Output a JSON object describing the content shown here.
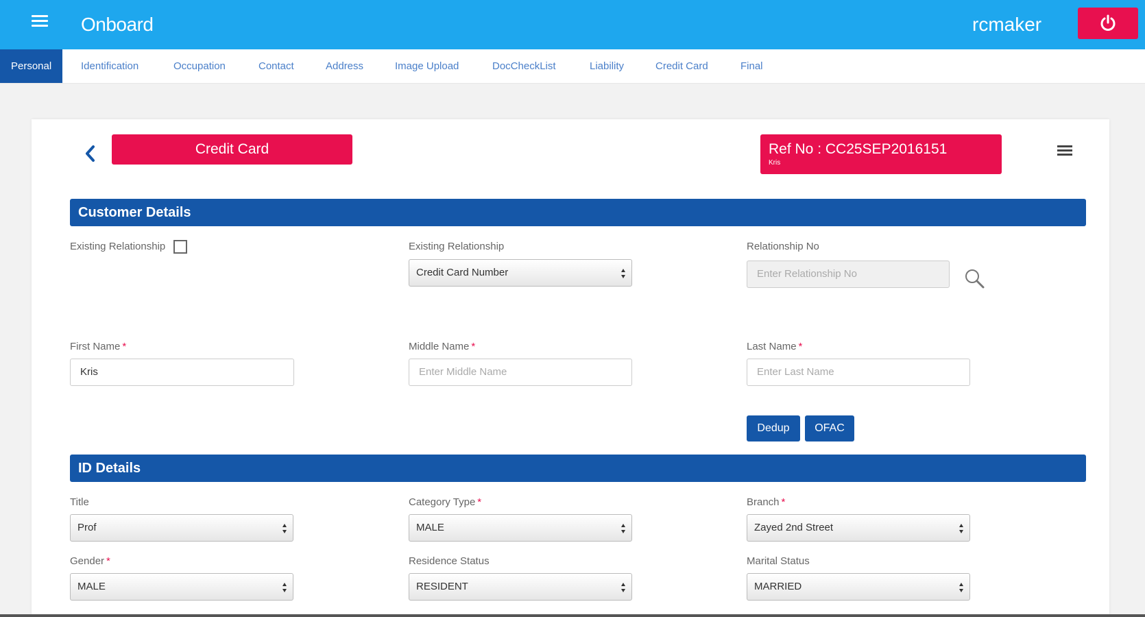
{
  "header": {
    "title": "Onboard",
    "username": "rcmaker"
  },
  "tabs": [
    {
      "label": "Personal",
      "active": true
    },
    {
      "label": "Identification"
    },
    {
      "label": "Occupation"
    },
    {
      "label": "Contact"
    },
    {
      "label": "Address"
    },
    {
      "label": "Image Upload"
    },
    {
      "label": "DocCheckList"
    },
    {
      "label": "Liability"
    },
    {
      "label": "Credit Card"
    },
    {
      "label": "Final"
    }
  ],
  "product": {
    "label": "Credit Card"
  },
  "reference": {
    "ref_no": "Ref No : CC25SEP2016151",
    "name": "Kris"
  },
  "customer_details": {
    "title": "Customer Details",
    "existing_relationship_checkbox_label": "Existing Relationship",
    "existing_relationship_checked": false,
    "existing_relationship_select_label": "Existing Relationship",
    "existing_relationship_select_value": "Credit Card Number",
    "relationship_no_label": "Relationship No",
    "relationship_no_placeholder": "Enter Relationship No",
    "first_name_label": "First Name",
    "first_name_value": "Kris",
    "middle_name_label": "Middle Name",
    "middle_name_placeholder": "Enter Middle Name",
    "last_name_label": "Last Name",
    "last_name_placeholder": "Enter Last Name",
    "dedup_label": "Dedup",
    "ofac_label": "OFAC"
  },
  "id_details": {
    "title": "ID Details",
    "title_label": "Title",
    "title_value": "Prof",
    "category_type_label": "Category Type",
    "category_type_value": "MALE",
    "branch_label": "Branch",
    "branch_value": "Zayed 2nd Street",
    "gender_label": "Gender",
    "gender_value": "MALE",
    "residence_status_label": "Residence Status",
    "residence_status_value": "RESIDENT",
    "marital_status_label": "Marital Status",
    "marital_status_value": "MARRIED"
  },
  "required_marker": "*",
  "colors": {
    "primary": "#1ea7ee",
    "dark_blue": "#1557a8",
    "accent": "#e8104f"
  },
  "icons": [
    "hamburger-icon",
    "power-icon",
    "back-chevron-icon",
    "menu-icon",
    "search-icon",
    "select-arrows-icon"
  ]
}
